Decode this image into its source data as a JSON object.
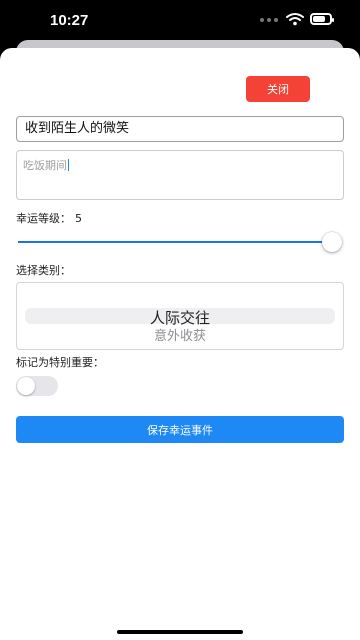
{
  "status_bar": {
    "time": "10:27",
    "icons": [
      "signal-dots-icon",
      "wifi-icon",
      "battery-icon"
    ]
  },
  "form": {
    "close_label": "关闭",
    "title_value": "收到陌生人的微笑",
    "description_value": "吃饭期间",
    "luck_label": "幸运等级：",
    "luck_value": "5",
    "luck_level": 5,
    "luck_max": 5,
    "category_label": "选择类别：",
    "category_selected": "人际交往",
    "category_next": "意外收获",
    "special_label": "标记为特别重要：",
    "special_on": false,
    "save_label": "保存幸运事件"
  },
  "colors": {
    "close_button": "#f44336",
    "save_button": "#1e88f5",
    "slider_fill": "#1a73e8"
  }
}
